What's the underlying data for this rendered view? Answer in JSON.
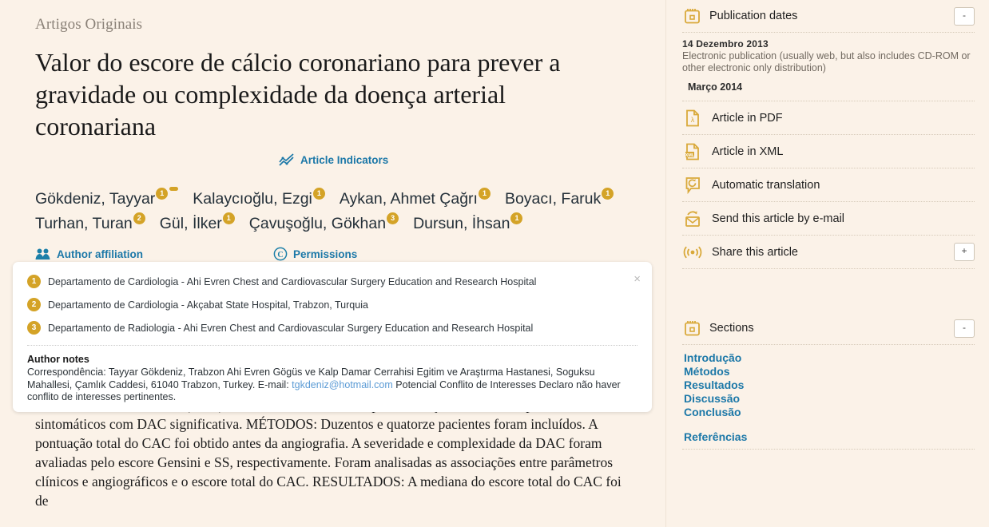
{
  "article": {
    "kicker": "Artigos Originais",
    "title": "Valor do escore de cálcio coronariano para prever a gravidade ou complexidade da doença arterial coronariana",
    "indicators_label": "Article Indicators",
    "author_affiliation_label": "Author affiliation",
    "permissions_label": "Permissions",
    "authors": [
      {
        "name": "Gökdeniz, Tayyar",
        "sup": "1",
        "corresponding": true
      },
      {
        "name": "Kalaycıoğlu, Ezgi",
        "sup": "1",
        "corresponding": false
      },
      {
        "name": "Aykan, Ahmet Çağrı",
        "sup": "1",
        "corresponding": false
      },
      {
        "name": "Boyacı, Faruk",
        "sup": "1",
        "corresponding": false
      },
      {
        "name": "Turhan, Turan",
        "sup": "2",
        "corresponding": false
      },
      {
        "name": "Gül, İlker",
        "sup": "1",
        "corresponding": false
      },
      {
        "name": "Çavuşoğlu, Gökhan",
        "sup": "3",
        "corresponding": false
      },
      {
        "name": "Dursun, İhsan",
        "sup": "1",
        "corresponding": false
      }
    ],
    "abstract_text": "cálcio arterial coronariano (CAC), um método não invasivo para avaliação de DAC em pacientes sintomáticos com DAC significativa. MÉTODOS: Duzentos e quatorze pacientes foram incluídos. A pontuação total do CAC foi obtido antes da angiografia. A severidade e complexidade da DAC foram avaliadas pelo escore Gensini e SS, respectivamente. Foram analisadas as associações entre parâmetros clínicos e angiográficos e o escore total do CAC. RESULTADOS: A mediana do escore total do CAC foi de"
  },
  "affiliation_popup": {
    "close_label": "×",
    "items": [
      {
        "badge": "1",
        "text": "Departamento de Cardiologia - Ahi Evren Chest and Cardiovascular Surgery Education and Research Hospital"
      },
      {
        "badge": "2",
        "text": "Departamento de Cardiologia - Akçabat State Hospital, Trabzon, Turquia"
      },
      {
        "badge": "3",
        "text": "Departamento de Radiologia - Ahi Evren Chest and Cardiovascular Surgery Education and Research Hospital"
      }
    ],
    "notes_title": "Author notes",
    "notes_part1": "Correspondência: Tayyar Gökdeniz, Trabzon Ahi Evren Gögüs ve Kalp Damar Cerrahisi Egitim ve Araştırma Hastanesi, Soguksu Mahallesi, Çamlık Caddesi, 61040 Trabzon, Turkey. E-mail: ",
    "notes_email": "tgkdeniz@hotmail.com",
    "notes_part2": " Potencial Conflito de Interesses Declaro não haver conflito de interesses pertinentes."
  },
  "sidebar": {
    "publication_dates": {
      "title": "Publication dates",
      "toggle": "-",
      "date_primary": "14  Dezembro 2013",
      "date_primary_desc": "Electronic publication (usually web, but also includes CD-ROM or other electronic only distribution)",
      "date_secondary": "Março 2014"
    },
    "actions": [
      {
        "label": "Article in PDF",
        "icon": "pdf-icon"
      },
      {
        "label": "Article in XML",
        "icon": "xml-icon"
      },
      {
        "label": "Automatic translation",
        "icon": "translate-icon"
      },
      {
        "label": "Send this article by e-mail",
        "icon": "email-icon"
      },
      {
        "label": "Share this article",
        "icon": "share-icon",
        "toggle": "+"
      }
    ],
    "sections": {
      "title": "Sections",
      "toggle": "-",
      "items": [
        "Introdução",
        "Métodos",
        "Resultados",
        "Discussão",
        "Conclusão"
      ],
      "references": "Referências"
    }
  },
  "colors": {
    "page_background": "#fbf2e8",
    "accent_gold": "#d4a327",
    "link_blue": "#1c78a8",
    "email_blue": "#5b9bd5",
    "muted_text": "#8a8177"
  }
}
